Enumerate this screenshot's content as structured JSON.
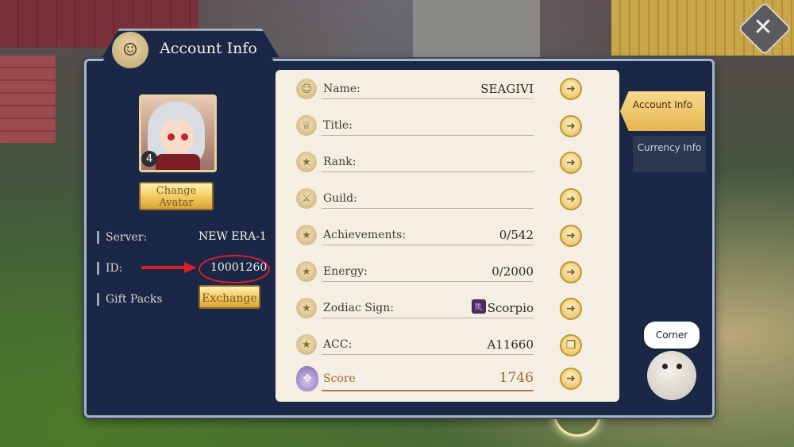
{
  "window": {
    "title": "Account Info"
  },
  "profile": {
    "level": "4",
    "change_avatar_label": "Change Avatar",
    "server_label": "Server:",
    "server_value": "NEW ERA-1",
    "id_label": "ID:",
    "id_value": "10001260",
    "gift_label": "Gift Packs",
    "exchange_label": "Exchange"
  },
  "rows": [
    {
      "label": "Name:",
      "value": "SEAGIVI"
    },
    {
      "label": "Title:",
      "value": ""
    },
    {
      "label": "Rank:",
      "value": ""
    },
    {
      "label": "Guild:",
      "value": ""
    },
    {
      "label": "Achievements:",
      "value": "0/542"
    },
    {
      "label": "Energy:",
      "value": "0/2000"
    },
    {
      "label": "Zodiac Sign:",
      "value": "Scorpio"
    },
    {
      "label": "ACC:",
      "value": "A11660"
    }
  ],
  "score": {
    "label": "Score",
    "value": "1746"
  },
  "tabs": {
    "account_info": "Account Info",
    "currency_info": "Currency Info"
  },
  "corner": {
    "label": "Corner"
  },
  "icons": {
    "close": "close-icon",
    "zodiac": "scorpio-icon",
    "row_button": "arrow-right-icon"
  },
  "colors": {
    "panel": "#1b2747",
    "card": "#f5efe3",
    "gold": "#f2c85e",
    "highlight_circle": "#d8202a",
    "score_text": "#a36a2b"
  }
}
